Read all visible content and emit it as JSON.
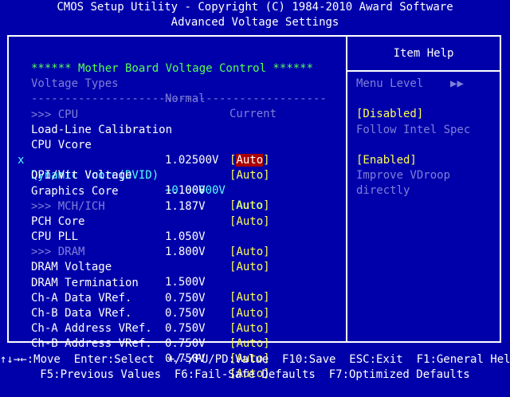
{
  "title": {
    "line1": "CMOS Setup Utility - Copyright (C) 1984-2010 Award Software",
    "line2": "Advanced Voltage Settings"
  },
  "left": {
    "header": "****** Mother Board Voltage Control ******",
    "columns": {
      "type": "Voltage Types",
      "normal": "Normal",
      "current": "Current"
    },
    "rule": "--------------------------------------------",
    "sections": {
      "cpu": ">>> CPU",
      "mch": ">>> MCH/ICH",
      "dram": ">>> DRAM"
    },
    "items": [
      {
        "name": "Load-Line Calibration",
        "normal": "",
        "current": "Auto"
      },
      {
        "name": "CPU Vcore",
        "normal": "1.02500V",
        "current": "Auto"
      },
      {
        "mark": "x",
        "name": "Dynamic Vcore(DVID)",
        "normal": "+0.00000V",
        "current": "Auto"
      },
      {
        "name": "QPI/Vtt Voltage",
        "normal": "1.100V",
        "current": "Auto"
      },
      {
        "name": "Graphics Core",
        "normal": "1.187V",
        "current": "Auto"
      },
      {
        "name": "PCH Core",
        "normal": "1.050V",
        "current": "Auto"
      },
      {
        "name": "CPU PLL",
        "normal": "1.800V",
        "current": "Auto"
      },
      {
        "name": "DRAM Voltage",
        "normal": "1.500V",
        "current": "Auto"
      },
      {
        "name": "DRAM Termination",
        "normal": "0.750V",
        "current": "Auto"
      },
      {
        "name": "Ch-A Data VRef.",
        "normal": "0.750V",
        "current": "Auto"
      },
      {
        "name": "Ch-B Data VRef.",
        "normal": "0.750V",
        "current": "Auto"
      },
      {
        "name": "Ch-A Address VRef.",
        "normal": "0.750V",
        "current": "Auto"
      },
      {
        "name": "Ch-B Address VRef.",
        "normal": "0.750V",
        "current": "Auto"
      }
    ]
  },
  "help": {
    "title": "Item Help",
    "menu_level": "Menu Level",
    "menu_arrows": "▶▶",
    "lines": [
      "[Disabled]",
      "Follow Intel Spec",
      "",
      "[Enabled]",
      "Improve VDroop",
      "directly"
    ]
  },
  "footer": {
    "line1": "↑↓→←:Move  Enter:Select  +/-/PU/PD:Value  F10:Save  ESC:Exit  F1:General Help",
    "line2": "F5:Previous Values  F6:Fail-Safe Defaults  F7:Optimized Defaults"
  },
  "colors": {
    "background": "#0000AA",
    "header": "#55FF55",
    "disabled": "#7F7FD8",
    "value": "#FFFF55",
    "highlight": "#AA0000"
  }
}
